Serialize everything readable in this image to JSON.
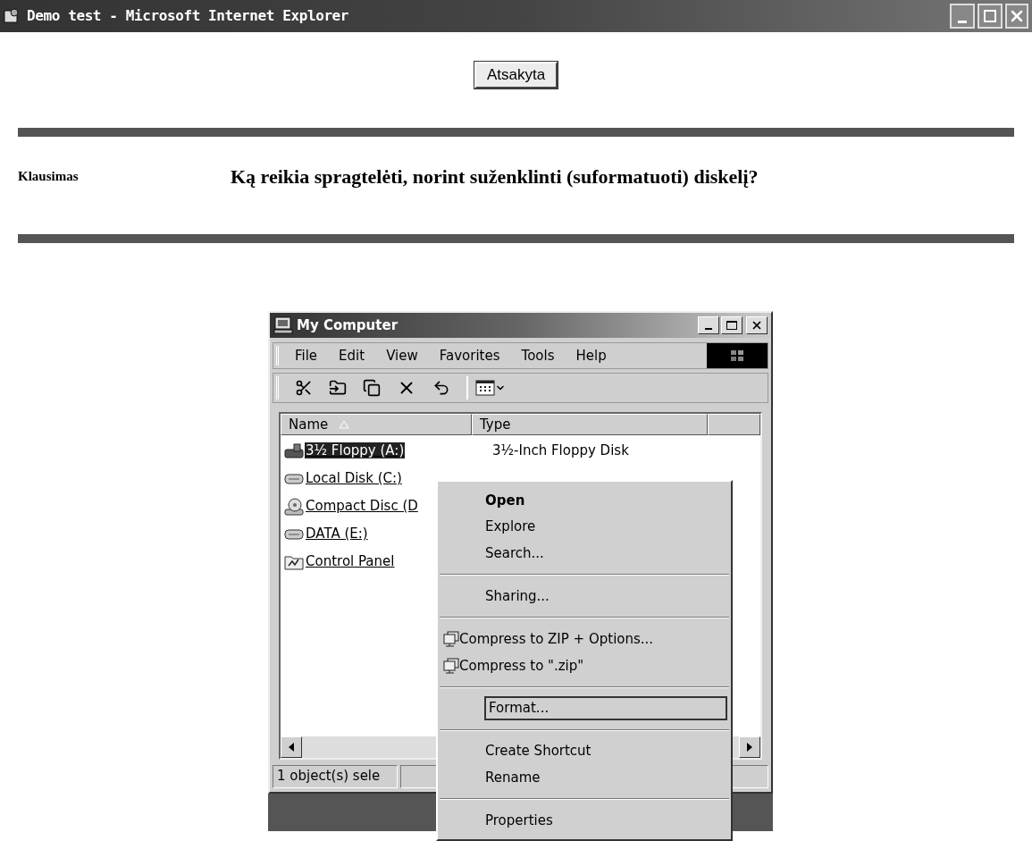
{
  "browser": {
    "title": "Demo test - Microsoft Internet Explorer"
  },
  "answer_button": "Atsakyta",
  "question": {
    "label": "Klausimas",
    "text": "Ką reikia spragtelėti, norint suženklinti (suformatuoti) diskelį?"
  },
  "explorer": {
    "title": "My Computer",
    "menu": [
      "File",
      "Edit",
      "View",
      "Favorites",
      "Tools",
      "Help"
    ],
    "columns": [
      {
        "label": "Name",
        "sorted": true
      },
      {
        "label": "Type",
        "sorted": false
      }
    ],
    "items": [
      {
        "kind": "floppy",
        "name": "3½ Floppy (A:)",
        "type": "3½-Inch Floppy Disk",
        "selected": true
      },
      {
        "kind": "disk",
        "name": "Local Disk (C:)",
        "selected": false
      },
      {
        "kind": "cd",
        "name": "Compact Disc (D",
        "selected": false
      },
      {
        "kind": "disk",
        "name": "DATA (E:)",
        "selected": false
      },
      {
        "kind": "control",
        "name": "Control Panel",
        "selected": false
      }
    ],
    "status": "1 object(s) sele"
  },
  "context_menu": [
    {
      "kind": "item",
      "label": "Open",
      "default": true,
      "focused": false
    },
    {
      "kind": "item",
      "label": "Explore",
      "default": false,
      "focused": false
    },
    {
      "kind": "item",
      "label": "Search...",
      "default": false,
      "focused": false
    },
    {
      "kind": "separator"
    },
    {
      "kind": "item",
      "label": "Sharing...",
      "default": false,
      "focused": false
    },
    {
      "kind": "separator"
    },
    {
      "kind": "zip",
      "label": "Compress to ZIP + Options...",
      "default": false,
      "focused": false
    },
    {
      "kind": "zip",
      "label": "Compress to \".zip\"",
      "default": false,
      "focused": false
    },
    {
      "kind": "separator"
    },
    {
      "kind": "item",
      "label": "Format...",
      "default": false,
      "focused": true
    },
    {
      "kind": "separator"
    },
    {
      "kind": "item",
      "label": "Create Shortcut",
      "default": false,
      "focused": false
    },
    {
      "kind": "item",
      "label": "Rename",
      "default": false,
      "focused": false
    },
    {
      "kind": "separator"
    },
    {
      "kind": "item",
      "label": "Properties",
      "default": false,
      "focused": false
    }
  ]
}
